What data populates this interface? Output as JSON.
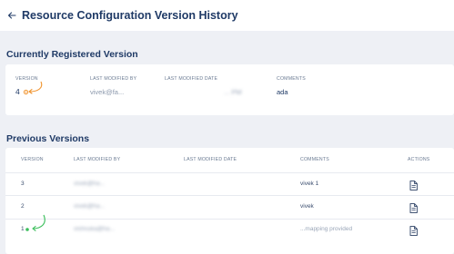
{
  "header": {
    "title": "Resource Configuration Version History"
  },
  "current": {
    "section_title": "Currently Registered Version",
    "columns": {
      "version": "VERSION",
      "modified_by": "LAST MODIFIED BY",
      "modified_date": "LAST MODIFIED DATE",
      "comments": "COMMENTS"
    },
    "version": "4",
    "modified_by": "vivek@fa...",
    "modified_date": "... PM",
    "comment": "ada"
  },
  "previous": {
    "section_title": "Previous Versions",
    "columns": {
      "version": "VERSION",
      "modified_by": "LAST MODIFIED BY",
      "modified_date": "LAST MODIFIED DATE",
      "comments": "COMMENTS",
      "actions": "ACTIONS"
    },
    "rows": [
      {
        "version": "3",
        "modified_by": "vivek@ha...",
        "modified_date": "",
        "comment": "vivek 1"
      },
      {
        "version": "2",
        "modified_by": "vivek@ha...",
        "modified_date": "",
        "comment": "vivek"
      },
      {
        "version": "1",
        "modified_by": "vishnuka@ha...",
        "modified_date": "",
        "comment": "...mapping provided"
      }
    ]
  },
  "colors": {
    "title": "#1f3a66",
    "accent_orange": "#f0922b",
    "accent_green": "#3cbf5c",
    "background": "#eef0f5"
  },
  "icons": {
    "back": "arrow-left-icon",
    "view": "document-icon",
    "current_marker": "gear-icon",
    "status_dot": "dot-icon"
  }
}
